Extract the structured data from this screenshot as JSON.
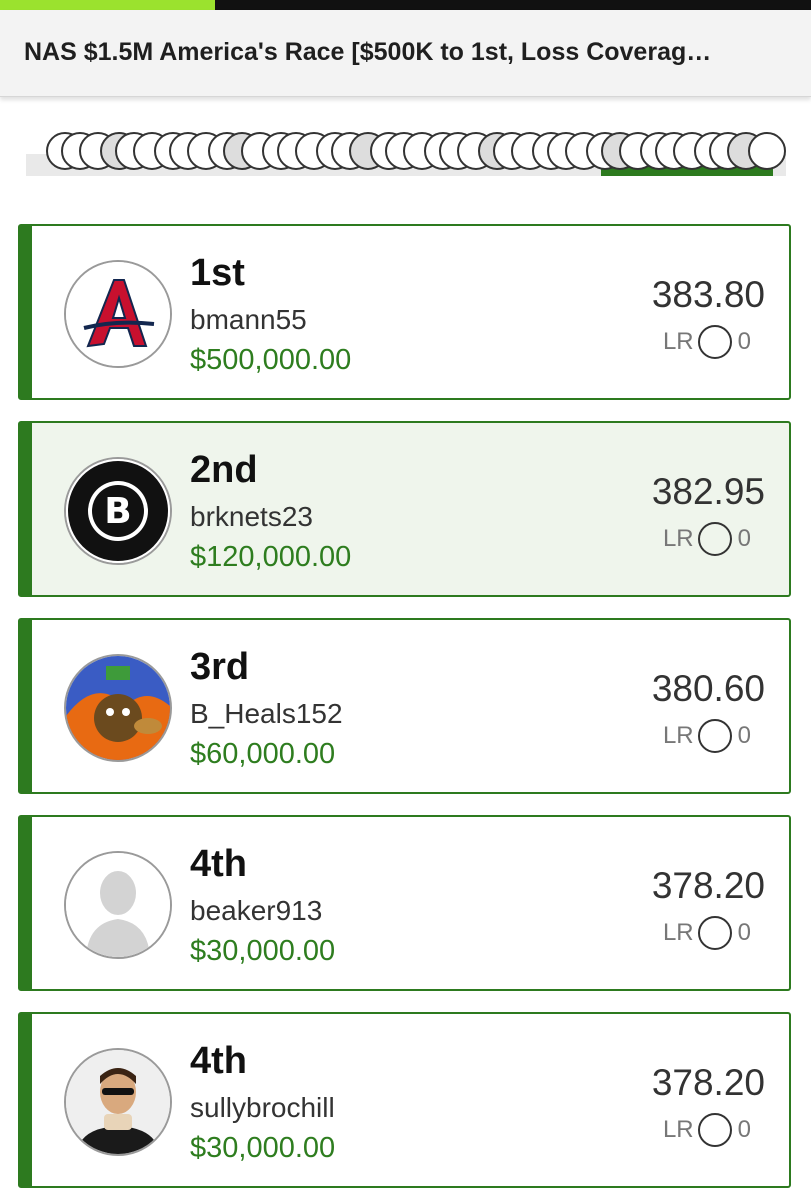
{
  "header": {
    "title": "NAS $1.5M America's Race [$500K to 1st, Loss Coverag…",
    "progress_fraction": 0.265
  },
  "colors": {
    "accent_green": "#2d7a1f",
    "prize_green": "#2e7d1f",
    "progress_green": "#9be22e"
  },
  "leaderboard": [
    {
      "rank": "1st",
      "username": "bmann55",
      "prize": "$500,000.00",
      "score": "383.80",
      "lr_label": "LR",
      "lr_value": "0",
      "avatar": "braves-a-logo",
      "highlight": false
    },
    {
      "rank": "2nd",
      "username": "brknets23",
      "prize": "$120,000.00",
      "score": "382.95",
      "lr_label": "LR",
      "lr_value": "0",
      "avatar": "brooklyn-nets-logo",
      "highlight": true
    },
    {
      "rank": "3rd",
      "username": "B_Heals152",
      "prize": "$60,000.00",
      "score": "380.60",
      "lr_label": "LR",
      "lr_value": "0",
      "avatar": "cartoon-avatar",
      "highlight": false
    },
    {
      "rank": "4th",
      "username": "beaker913",
      "prize": "$30,000.00",
      "score": "378.20",
      "lr_label": "LR",
      "lr_value": "0",
      "avatar": "default-silhouette",
      "highlight": false
    },
    {
      "rank": "4th",
      "username": "sullybrochill",
      "prize": "$30,000.00",
      "score": "378.20",
      "lr_label": "LR",
      "lr_value": "0",
      "avatar": "photo-avatar",
      "highlight": false
    }
  ]
}
